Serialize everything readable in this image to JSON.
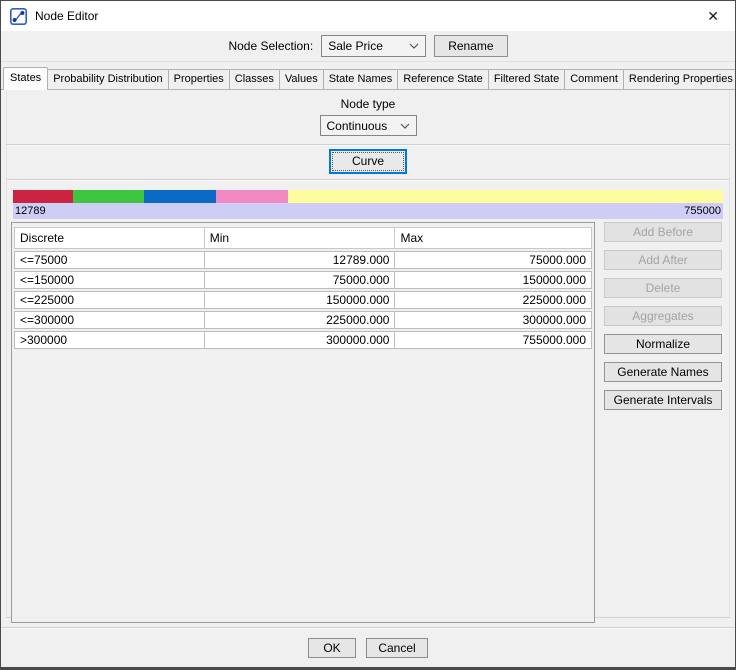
{
  "window": {
    "title": "Node Editor",
    "close_glyph": "✕"
  },
  "toolbar": {
    "node_selection_label": "Node Selection:",
    "selected_node": "Sale Price",
    "rename_label": "Rename"
  },
  "tabs": [
    {
      "label": "States",
      "active": true
    },
    {
      "label": "Probability Distribution",
      "active": false
    },
    {
      "label": "Properties",
      "active": false
    },
    {
      "label": "Classes",
      "active": false
    },
    {
      "label": "Values",
      "active": false
    },
    {
      "label": "State Names",
      "active": false
    },
    {
      "label": "Reference State",
      "active": false
    },
    {
      "label": "Filtered State",
      "active": false
    },
    {
      "label": "Comment",
      "active": false
    },
    {
      "label": "Rendering Properties",
      "active": false
    }
  ],
  "states_tab": {
    "node_type_label": "Node type",
    "node_type_value": "Continuous",
    "curve_button_label": "Curve",
    "colorbar": {
      "min_label": "12789",
      "max_label": "755000",
      "track_color": "#cdcdf6",
      "segments": [
        {
          "color": "#cb2340",
          "width_pct": 8.4
        },
        {
          "color": "#3fc43f",
          "width_pct": 10.1
        },
        {
          "color": "#0a6ac4",
          "width_pct": 10.1
        },
        {
          "color": "#f08ac2",
          "width_pct": 10.1
        },
        {
          "color": "#fdfd9f",
          "width_pct": 61.3
        }
      ]
    },
    "table": {
      "columns": [
        "Discrete",
        "Min",
        "Max"
      ],
      "rows": [
        {
          "discrete": "<=75000",
          "min": "12789.000",
          "max": "75000.000"
        },
        {
          "discrete": "<=150000",
          "min": "75000.000",
          "max": "150000.000"
        },
        {
          "discrete": "<=225000",
          "min": "150000.000",
          "max": "225000.000"
        },
        {
          "discrete": "<=300000",
          "min": "225000.000",
          "max": "300000.000"
        },
        {
          "discrete": ">300000",
          "min": "300000.000",
          "max": "755000.000"
        }
      ]
    },
    "side_buttons": [
      {
        "label": "Add Before",
        "enabled": false
      },
      {
        "label": "Add After",
        "enabled": false
      },
      {
        "label": "Delete",
        "enabled": false
      },
      {
        "label": "Aggregates",
        "enabled": false
      },
      {
        "label": "Normalize",
        "enabled": true
      },
      {
        "label": "Generate Names",
        "enabled": true
      },
      {
        "label": "Generate Intervals",
        "enabled": true
      }
    ]
  },
  "footer": {
    "ok_label": "OK",
    "cancel_label": "Cancel"
  },
  "colors": {
    "accent": "#0078d7",
    "title_bar_bg": "#ffffff",
    "panel_bg": "#f0f0f0"
  }
}
